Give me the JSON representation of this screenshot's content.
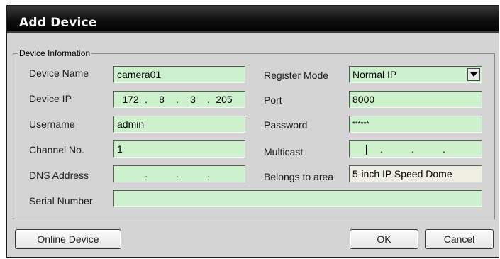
{
  "dialog": {
    "title": "Add Device"
  },
  "group": {
    "legend": "Device Information"
  },
  "fields": {
    "device_name": {
      "label": "Device Name",
      "value": "camera01"
    },
    "device_ip": {
      "label": "Device IP",
      "octets": [
        "172",
        "8",
        "3",
        "205"
      ]
    },
    "username": {
      "label": "Username",
      "value": "admin"
    },
    "channel_no": {
      "label": "Channel No.",
      "value": "1"
    },
    "dns_address": {
      "label": "DNS Address",
      "octets": [
        "",
        "",
        "",
        ""
      ]
    },
    "serial_number": {
      "label": "Serial Number",
      "value": ""
    },
    "register_mode": {
      "label": "Register Mode",
      "value": "Normal IP"
    },
    "port": {
      "label": "Port",
      "value": "8000"
    },
    "password": {
      "label": "Password",
      "value": "******"
    },
    "multicast": {
      "label": "Multicast",
      "octets": [
        "",
        "",
        "",
        ""
      ]
    },
    "belongs_to_area": {
      "label": "Belongs to area",
      "value": "5-inch IP Speed Dome"
    }
  },
  "buttons": {
    "online_device": "Online Device",
    "ok": "OK",
    "cancel": "Cancel"
  },
  "icons": {
    "dropdown": "chevron-down-icon"
  },
  "colors": {
    "field_bg": "#cdf0cd",
    "readonly_bg": "#efeee2",
    "titlebar": "#000000",
    "dialog_bg": "#d4d4d4"
  }
}
